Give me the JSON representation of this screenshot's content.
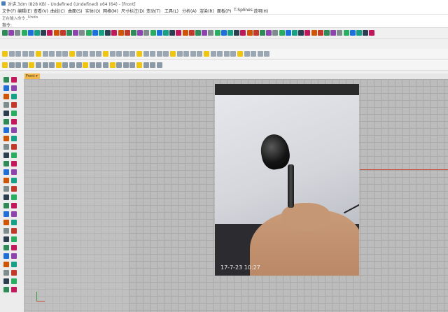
{
  "window": {
    "title": "对讲.3dm (828 KB) - Undefined (Undefined) x64 (64) - [Front]"
  },
  "menu": {
    "items": [
      "文件(F)",
      "编辑(E)",
      "查看(V)",
      "曲线(C)",
      "曲面(S)",
      "实体(O)",
      "网格(M)",
      "尺寸标注(D)",
      "变动(T)",
      "工具(L)",
      "分析(A)",
      "渲染(R)",
      "面板(P)",
      "T-Splines",
      "说明(H)"
    ]
  },
  "command_history": {
    "line1": "正在输入命令",
    "line2": "_Undo"
  },
  "command_prompt": {
    "label": "指令:"
  },
  "viewport": {
    "tab_label": "Front"
  },
  "photo": {
    "timestamp": "17-7-23 10:27"
  },
  "colors": {
    "accent": "#f4b84a",
    "grid": "#bcbcbc",
    "x_axis": "#c84a3a",
    "y_axis": "#3a9a3a"
  }
}
